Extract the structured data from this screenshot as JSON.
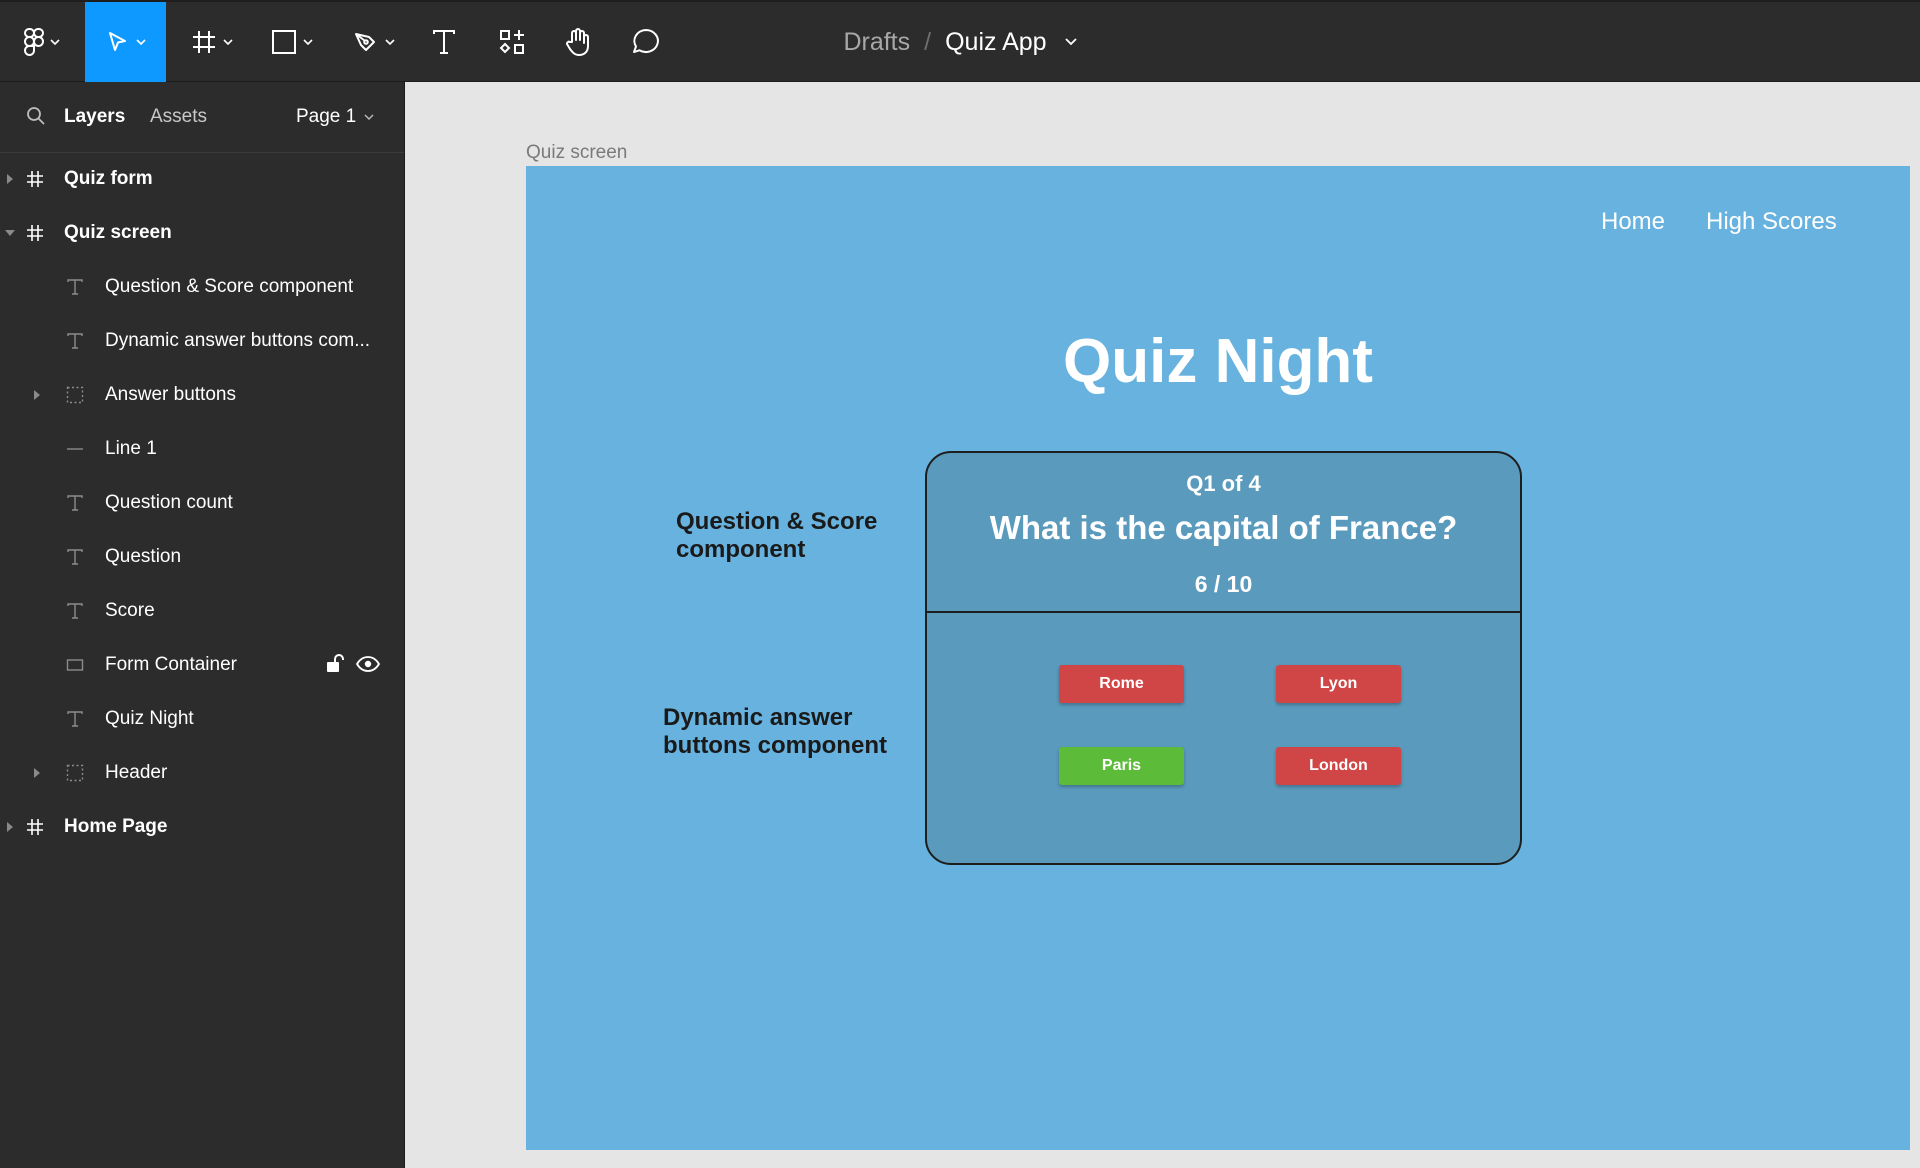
{
  "toolbar": {
    "breadcrumb_parent": "Drafts",
    "breadcrumb_separator": "/",
    "file_name": "Quiz App",
    "active_tool": "move",
    "active_color": "#0d99ff"
  },
  "panel": {
    "tab_layers": "Layers",
    "tab_assets": "Assets",
    "page_label": "Page 1",
    "layers": [
      {
        "label": "Quiz form",
        "icon": "frame-icon"
      },
      {
        "label": "Quiz screen",
        "icon": "frame-icon"
      },
      {
        "label": "Question & Score component",
        "icon": "text-icon"
      },
      {
        "label": "Dynamic answer buttons com...",
        "icon": "text-icon"
      },
      {
        "label": "Answer buttons",
        "icon": "group-icon"
      },
      {
        "label": "Line 1",
        "icon": "line-icon"
      },
      {
        "label": "Question count",
        "icon": "text-icon"
      },
      {
        "label": "Question",
        "icon": "text-icon"
      },
      {
        "label": "Score",
        "icon": "text-icon"
      },
      {
        "label": "Form Container",
        "icon": "rectangle-icon"
      },
      {
        "label": "Quiz Night",
        "icon": "text-icon"
      },
      {
        "label": "Header",
        "icon": "group-icon"
      },
      {
        "label": "Home Page",
        "icon": "frame-icon"
      }
    ]
  },
  "canvas": {
    "frame_label": "Quiz screen",
    "frame_color": "#67b2de",
    "nav_home": "Home",
    "nav_high_scores": "High Scores",
    "title": "Quiz Night",
    "annotation_question_score": [
      "Question & Score",
      "component"
    ],
    "annotation_dynamic": [
      "Dynamic answer",
      "buttons component"
    ],
    "question_count": "Q1 of 4",
    "question": "What is the capital of France?",
    "score": "6 / 10",
    "answers": [
      {
        "label": "Rome",
        "color": "#d04545"
      },
      {
        "label": "Lyon",
        "color": "#d04545"
      },
      {
        "label": "Paris",
        "color": "#5dbb3a"
      },
      {
        "label": "London",
        "color": "#d04545"
      }
    ]
  }
}
